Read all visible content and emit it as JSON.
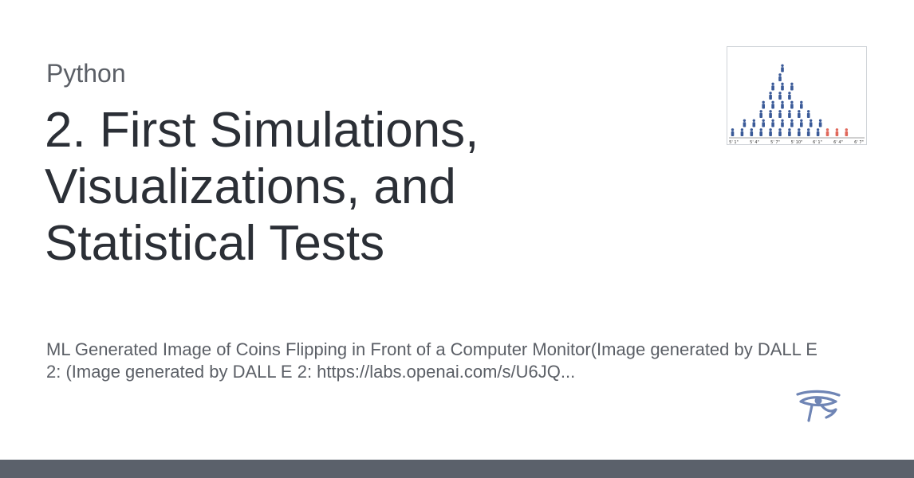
{
  "category": "Python",
  "title": "2. First Simulations, Visualizations, and Statistical Tests",
  "description": "ML Generated Image of Coins Flipping in Front of a Computer Monitor(Image generated by DALL E 2: (Image generated by DALL E 2: https://labs.openai.com/s/U6JQ...",
  "thumbnail": {
    "tick_labels": [
      "5' 1\"",
      "5' 4\"",
      "5' 7\"",
      "5' 10\"",
      "6' 1\"",
      "6' 4\"",
      "6' 7\""
    ],
    "colors": {
      "main": "#3a5a98",
      "highlight": "#e0675a"
    }
  },
  "logo": {
    "icon": "eye-of-horus-icon",
    "color": "#6f85b5"
  },
  "colors": {
    "title": "#2b2f36",
    "muted": "#5b5f66",
    "footer": "#5b616b"
  }
}
